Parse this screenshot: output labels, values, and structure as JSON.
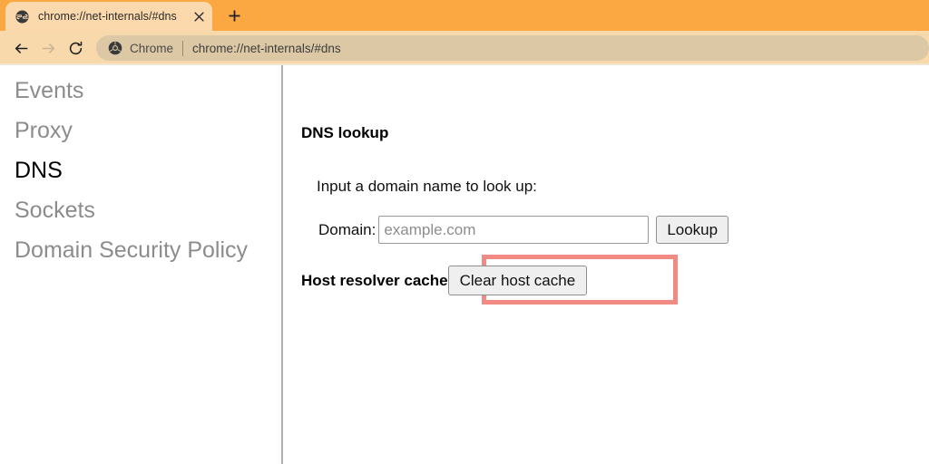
{
  "browser": {
    "tab": {
      "favicon": "globe-icon",
      "title": "chrome://net-internals/#dns",
      "close_label": "×"
    },
    "new_tab_label": "+",
    "nav": {
      "back_label": "←",
      "forward_label": "→",
      "reload_label": "↻"
    },
    "omnibox": {
      "icon": "chrome-logo-icon",
      "chip_label": "Chrome",
      "url": "chrome://net-internals/#dns"
    },
    "colors": {
      "tabstrip_bg": "#fba742",
      "active_tab_bg": "#fbd9ac",
      "toolbar_bg": "#f7d9ab",
      "omnibox_bg": "#dcc8a4",
      "highlight": "#f08a83"
    }
  },
  "sidebar": {
    "items": [
      {
        "label": "Events",
        "selected": false
      },
      {
        "label": "Proxy",
        "selected": false
      },
      {
        "label": "DNS",
        "selected": true
      },
      {
        "label": "Sockets",
        "selected": false
      },
      {
        "label": "Domain Security Policy",
        "selected": false
      }
    ]
  },
  "main": {
    "section_title": "DNS lookup",
    "prompt": "Input a domain name to look up:",
    "domain_label": "Domain:",
    "domain_value": "",
    "domain_placeholder": "example.com",
    "lookup_button": "Lookup",
    "cache_label": "Host resolver cache",
    "clear_button": "Clear host cache"
  }
}
